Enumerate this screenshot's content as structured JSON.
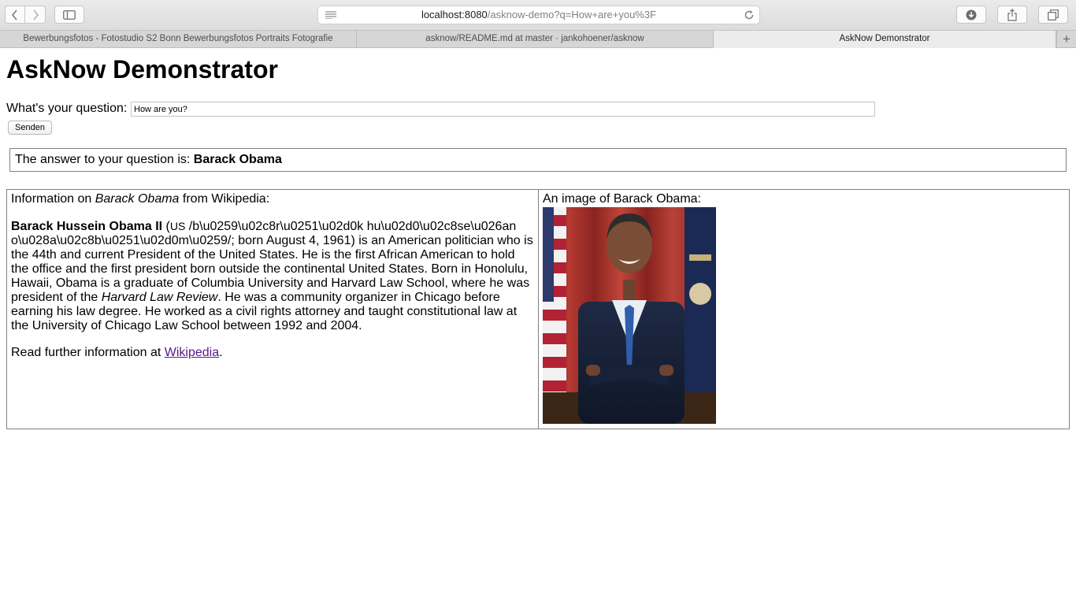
{
  "browser": {
    "address_host": "localhost:8080",
    "address_path": "/asknow-demo?q=How+are+you%3F",
    "tabs": [
      {
        "label": "Bewerbungsfotos - Fotostudio S2 Bonn Bewerbungsfotos Portraits Fotografie"
      },
      {
        "label": "asknow/README.md at master · jankohoener/asknow"
      },
      {
        "label": "AskNow Demonstrator"
      }
    ],
    "new_tab_label": "+"
  },
  "page": {
    "title": "AskNow Demonstrator",
    "question_label": "What's your question:",
    "question_value": "How are you?",
    "submit_label": "Senden",
    "answer_prefix": "The answer to your question is: ",
    "answer_value": "Barack Obama"
  },
  "info": {
    "heading_prefix": "Information on ",
    "heading_entity": "Barack Obama",
    "heading_suffix": " from Wikipedia:",
    "bold_name": "Barack Hussein Obama II",
    "pron_open": " (",
    "pron_us": "US",
    "text_part1": " /b\\u0259\\u02c8r\\u0251\\u02d0k hu\\u02d0\\u02c8se\\u026an o\\u028a\\u02c8b\\u0251\\u02d0m\\u0259/; born August 4, 1961) is an American politician who is the 44th and current President of the United States. He is the first African American to hold the office and the first president born outside the continental United States. Born in Honolulu, Hawaii, Obama is a graduate of Columbia University and Harvard Law School, where he was president of the ",
    "text_italic": "Harvard Law Review",
    "text_part2": ". He was a community organizer in Chicago before earning his law degree. He worked as a civil rights attorney and taught constitutional law at the University of Chicago Law School between 1992 and 2004.",
    "further_prefix": "Read further information at ",
    "further_link": "Wikipedia",
    "further_suffix": "."
  },
  "image_panel": {
    "caption": "An image of Barack Obama:"
  }
}
